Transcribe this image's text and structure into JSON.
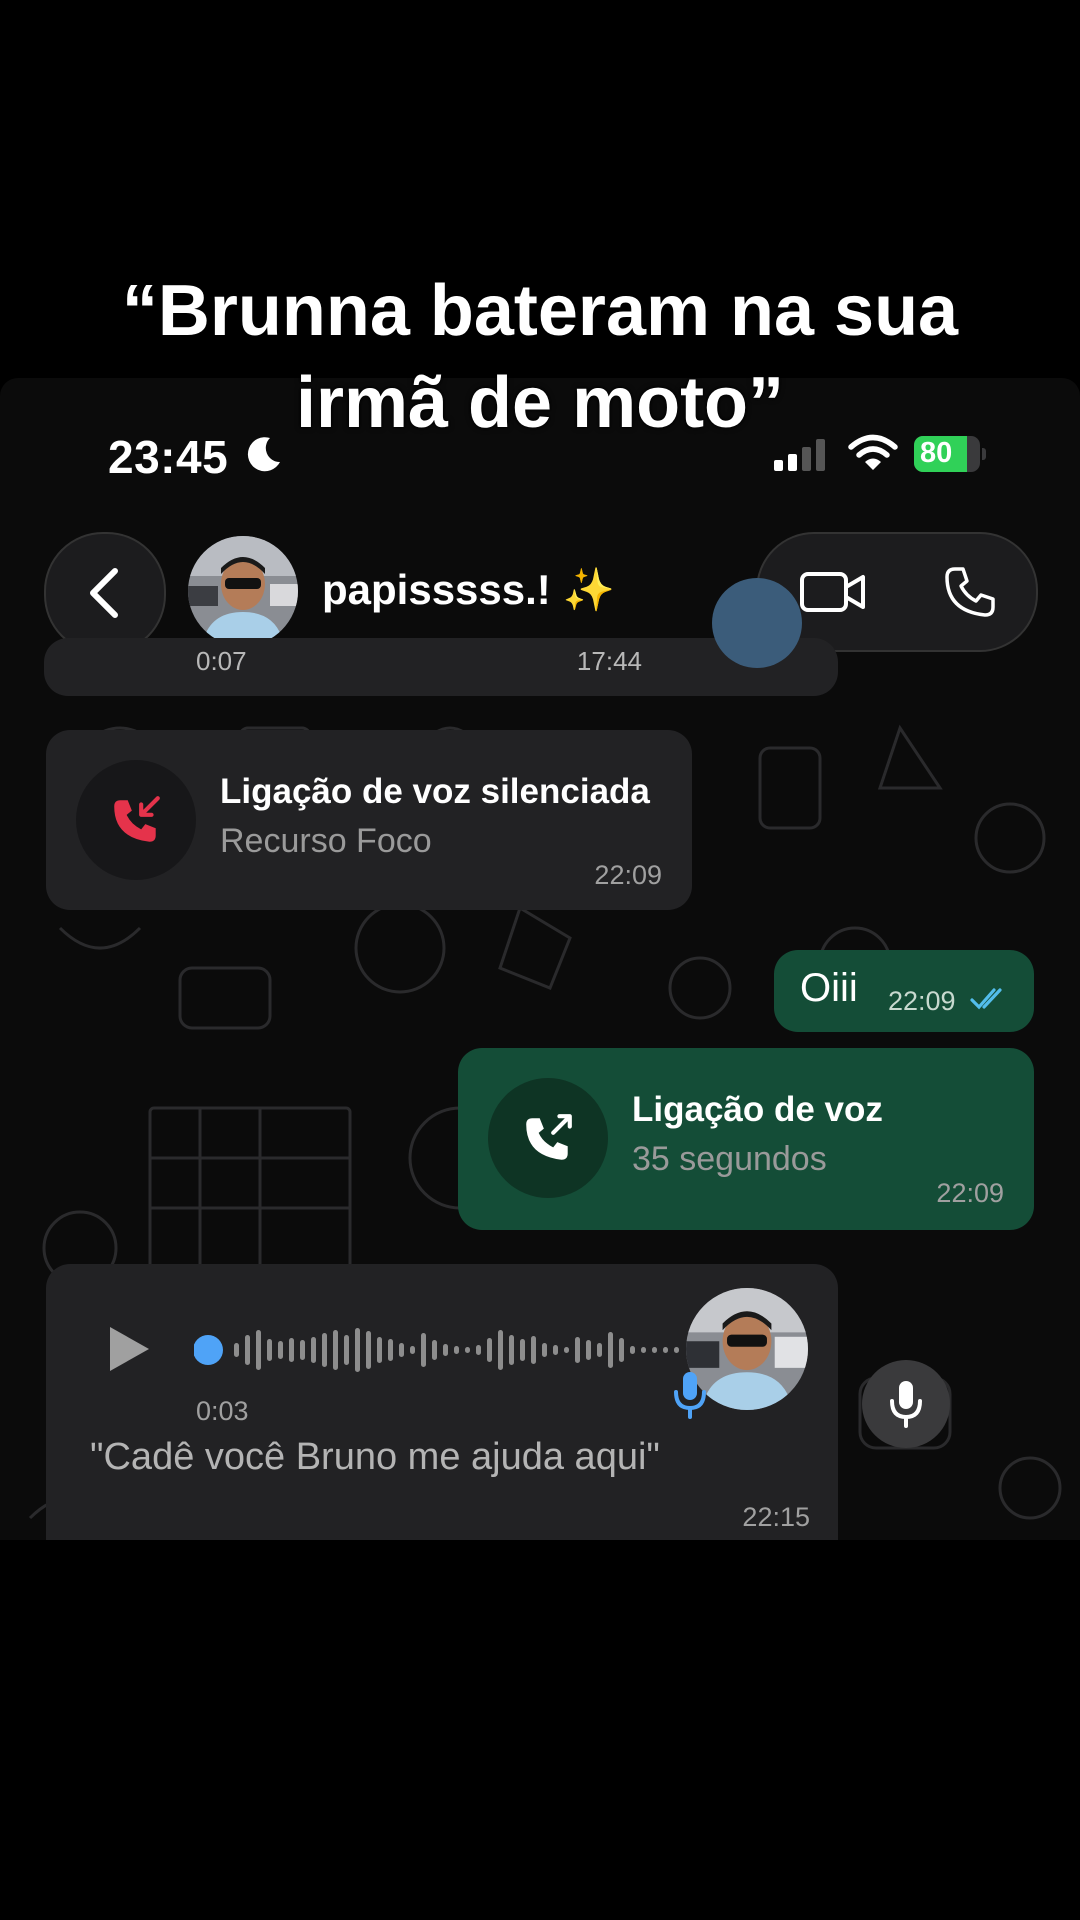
{
  "caption": {
    "line1": "“Brunna bateram na sua",
    "line2": "irmã de moto”"
  },
  "status_bar": {
    "time": "23:45",
    "battery": "80",
    "battery_level": 0.8,
    "icons": [
      "moon-icon",
      "signal-icon",
      "wifi-icon",
      "battery-icon"
    ]
  },
  "header": {
    "contact_name": "papisssss.! ✨",
    "buttons": [
      "back-icon",
      "video-call-icon",
      "phone-call-icon"
    ]
  },
  "messages": {
    "partial": {
      "duration": "0:07",
      "time": "17:44"
    },
    "missed_call": {
      "title": "Ligação de voz silenciada",
      "subtitle": "Recurso Foco",
      "time": "22:09",
      "icon": "missed-call-icon"
    },
    "text_out": {
      "text": "Oiii",
      "time": "22:09",
      "status": "read"
    },
    "voice_call_out": {
      "title": "Ligação de voz",
      "subtitle": "35 segundos",
      "time": "22:09",
      "icon": "outgoing-call-icon"
    },
    "voice_note": {
      "duration": "0:03",
      "transcript": "\"Cadê você Bruno me ajuda aqui\"",
      "time": "22:15",
      "progress": 0.0
    }
  },
  "colors": {
    "outgoing_bubble": "#144d37",
    "incoming_bubble": "#222224",
    "missed_call_red": "#e5334b",
    "read_ticks": "#53bdeb",
    "voice_blue": "#4fa3f7"
  }
}
